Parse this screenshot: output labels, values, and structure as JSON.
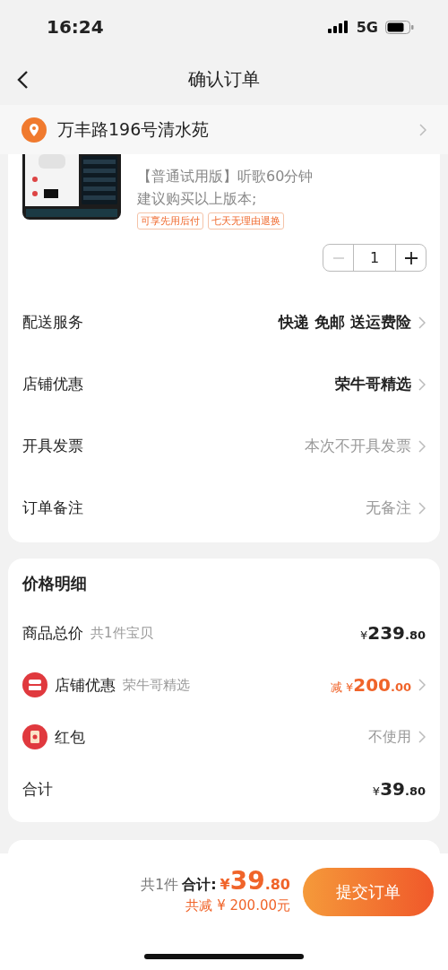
{
  "status_bar": {
    "time": "16:24",
    "network": "5G"
  },
  "nav": {
    "title": "确认订单"
  },
  "address": {
    "text": "万丰路196号清水苑"
  },
  "product": {
    "spec_lines": [
      "【普通试用版】听歌60分钟",
      "建议购买以上版本;"
    ],
    "tags": [
      "可享先用后付",
      "七天无理由退换"
    ],
    "quantity": "1",
    "minus_disabled": true
  },
  "order_options": [
    {
      "label": "配送服务",
      "value": "快递 免邮 送运费险",
      "emphasis": true
    },
    {
      "label": "店铺优惠",
      "value": "荣牛哥精选",
      "emphasis": true
    },
    {
      "label": "开具发票",
      "value": "本次不开具发票",
      "emphasis": false
    },
    {
      "label": "订单备注",
      "value": "无备注",
      "emphasis": false
    }
  ],
  "price_details": {
    "title": "价格明细",
    "rows": [
      {
        "kind": "amount",
        "label": "商品总价",
        "note": "共1件宝贝",
        "currency": "¥",
        "integer": "239",
        "decimal": ".80"
      },
      {
        "kind": "coupon",
        "label": "店铺优惠",
        "note": "荣牛哥精选",
        "prefix": "减",
        "currency": "¥",
        "integer": "200",
        "decimal": ".00"
      },
      {
        "kind": "packet",
        "label": "红包",
        "value": "不使用"
      },
      {
        "kind": "amount",
        "label": "合计",
        "currency": "¥",
        "integer": "39",
        "decimal": ".80"
      }
    ]
  },
  "bottom_bar": {
    "count": "共1件",
    "total_label": "合计:",
    "currency": "¥",
    "integer": "39",
    "decimal": ".80",
    "saved": "共减 ¥ 200.00元",
    "submit": "提交订单"
  }
}
